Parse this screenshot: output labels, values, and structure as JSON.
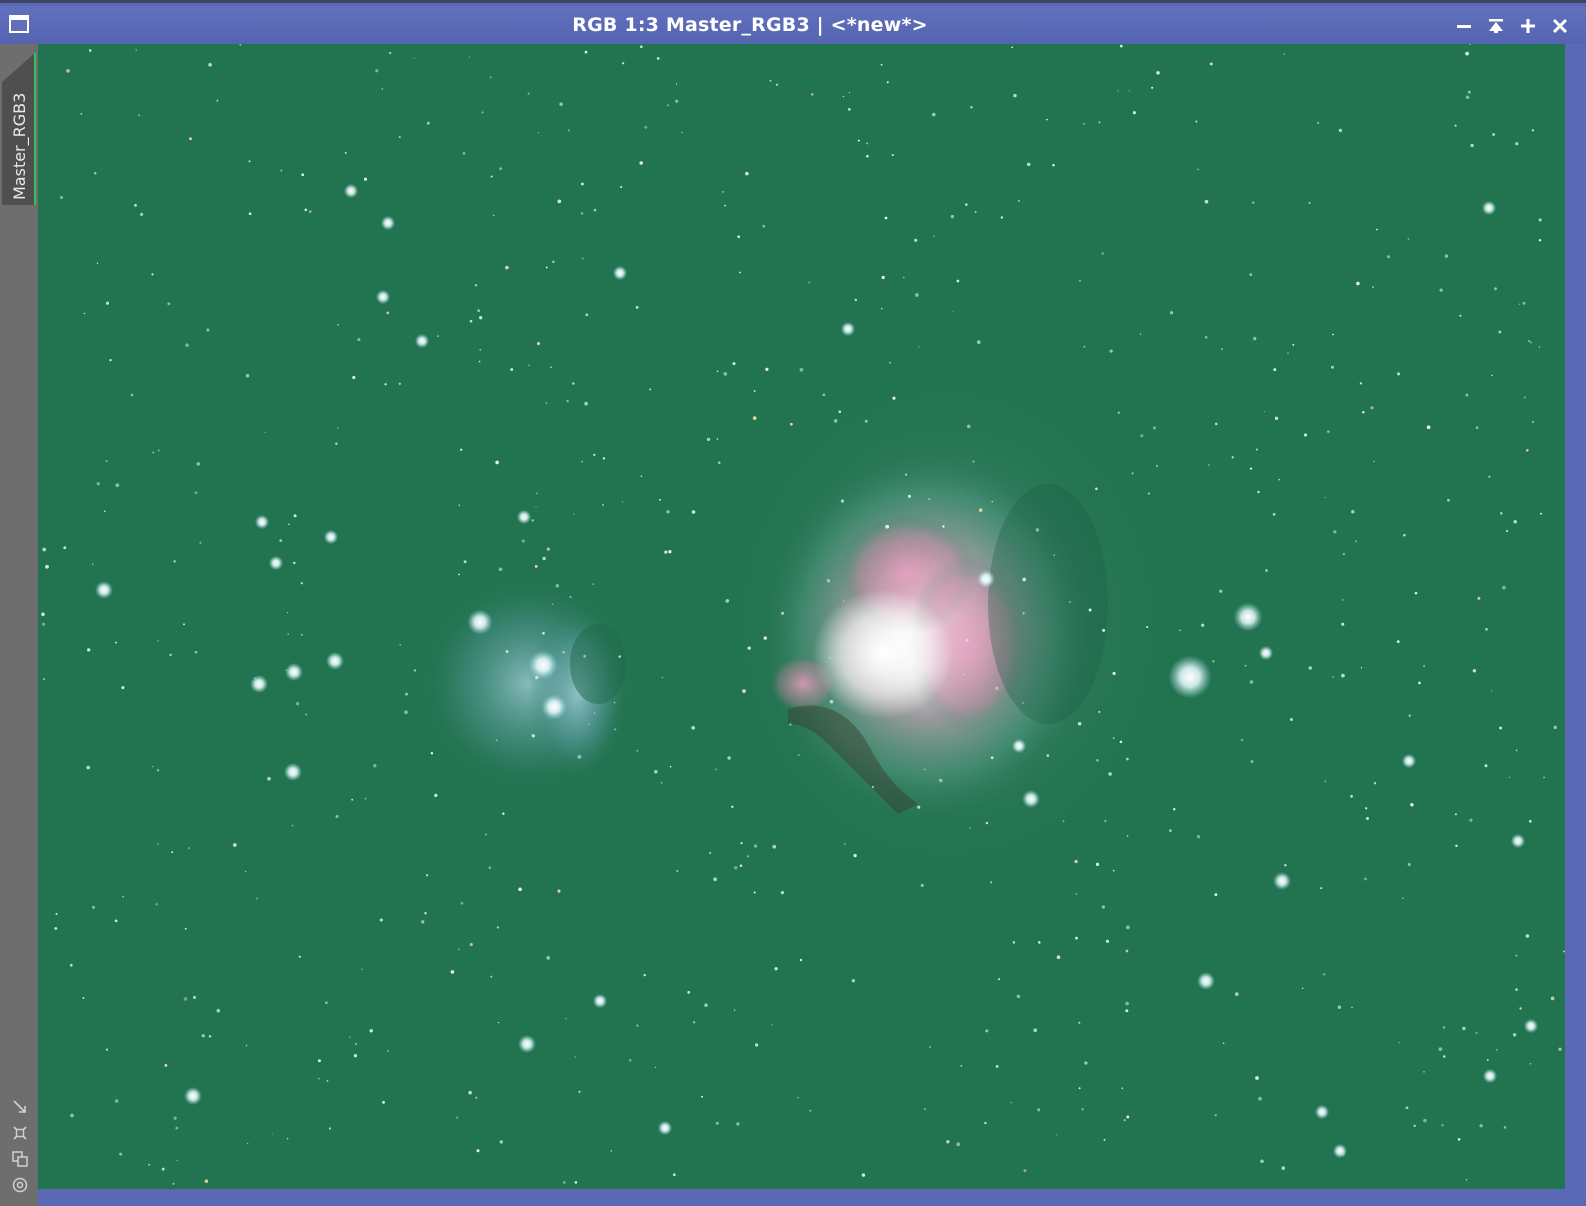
{
  "window": {
    "title": "RGB 1:3 Master_RGB3 | <*new*>",
    "menu_icon": "window-menu-icon",
    "controls": [
      {
        "name": "minimize-button",
        "icon": "minimize-icon"
      },
      {
        "name": "shade-button",
        "icon": "shade-icon"
      },
      {
        "name": "maximize-button",
        "icon": "plus-icon"
      },
      {
        "name": "close-button",
        "icon": "close-icon"
      }
    ]
  },
  "view_tab": {
    "label": "Master_RGB3"
  },
  "side_icons": [
    "expand-arrow-icon",
    "fit-frame-icon",
    "clone-icon",
    "target-icon"
  ],
  "colors": {
    "title_bar": "#5a68b5",
    "image_background": "#227350",
    "side_panel": "#6e6e6e",
    "tab_accent": "#2ec45a"
  }
}
